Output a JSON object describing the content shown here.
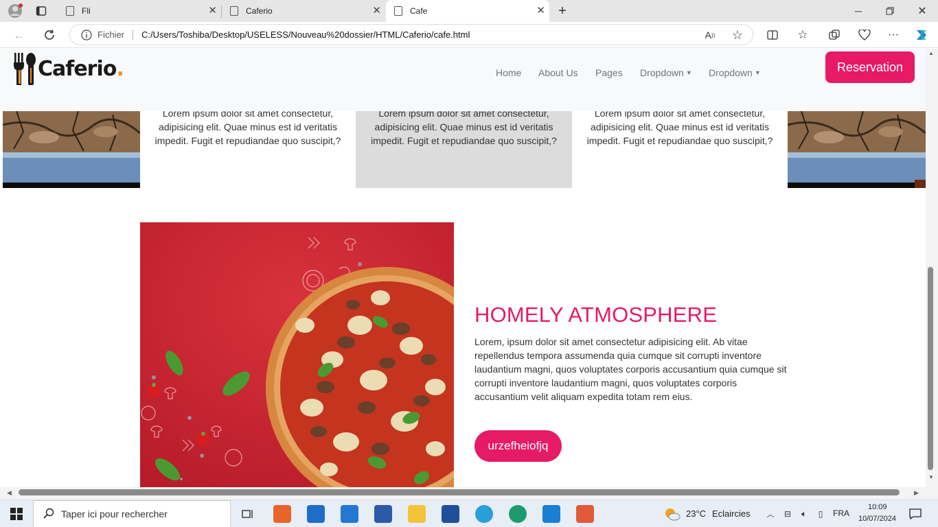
{
  "browser": {
    "tabs": [
      {
        "title": "Fli"
      },
      {
        "title": "Caferio"
      },
      {
        "title": "Cafe"
      }
    ],
    "address": {
      "scheme_label": "Fichier",
      "url": "C:/Users/Toshiba/Desktop/USELESS/Nouveau%20dossier/HTML/Caferio/cafe.html"
    }
  },
  "site": {
    "logo_text": "Caferio",
    "logo_dot": ".",
    "nav": {
      "home": "Home",
      "about": "About Us",
      "pages": "Pages",
      "dropdown1": "Dropdown",
      "dropdown2": "Dropdown"
    },
    "reservation_label": "Reservation",
    "cards": [
      {
        "text": "Lorem ipsum dolor sit amet consectetur, adipisicing elit. Quae minus est id veritatis impedit. Fugit et repudiandae quo suscipit,?"
      },
      {
        "text": "Lorem ipsum dolor sit amet consectetur, adipisicing elit. Quae minus est id veritatis impedit. Fugit et repudiandae quo suscipit,?"
      },
      {
        "text": "Lorem ipsum dolor sit amet consectetur, adipisicing elit. Quae minus est id veritatis impedit. Fugit et repudiandae quo suscipit,?"
      }
    ],
    "feature": {
      "title": "HOMELY ATMOSPHERE",
      "text": "Lorem, ipsum dolor sit amet consectetur adipisicing elit. Ab vitae repellendus tempora assumenda quia cumque sit corrupti inventore laudantium magni, quos voluptates corporis accusantium quia cumque sit corrupti inventore laudantium magni, quos voluptates corporis accusantium velit aliquam expedita totam rem eius.",
      "button": "urzefheiofjq"
    },
    "colors": {
      "accent": "#e61a66",
      "logo_orange": "#f0901e"
    }
  },
  "taskbar": {
    "search_placeholder": "Taper ici pour rechercher",
    "weather": {
      "temp": "23°C",
      "condition": "Eclaircies"
    },
    "lang": "FRA",
    "time": "10:09",
    "date": "10/07/2024"
  }
}
